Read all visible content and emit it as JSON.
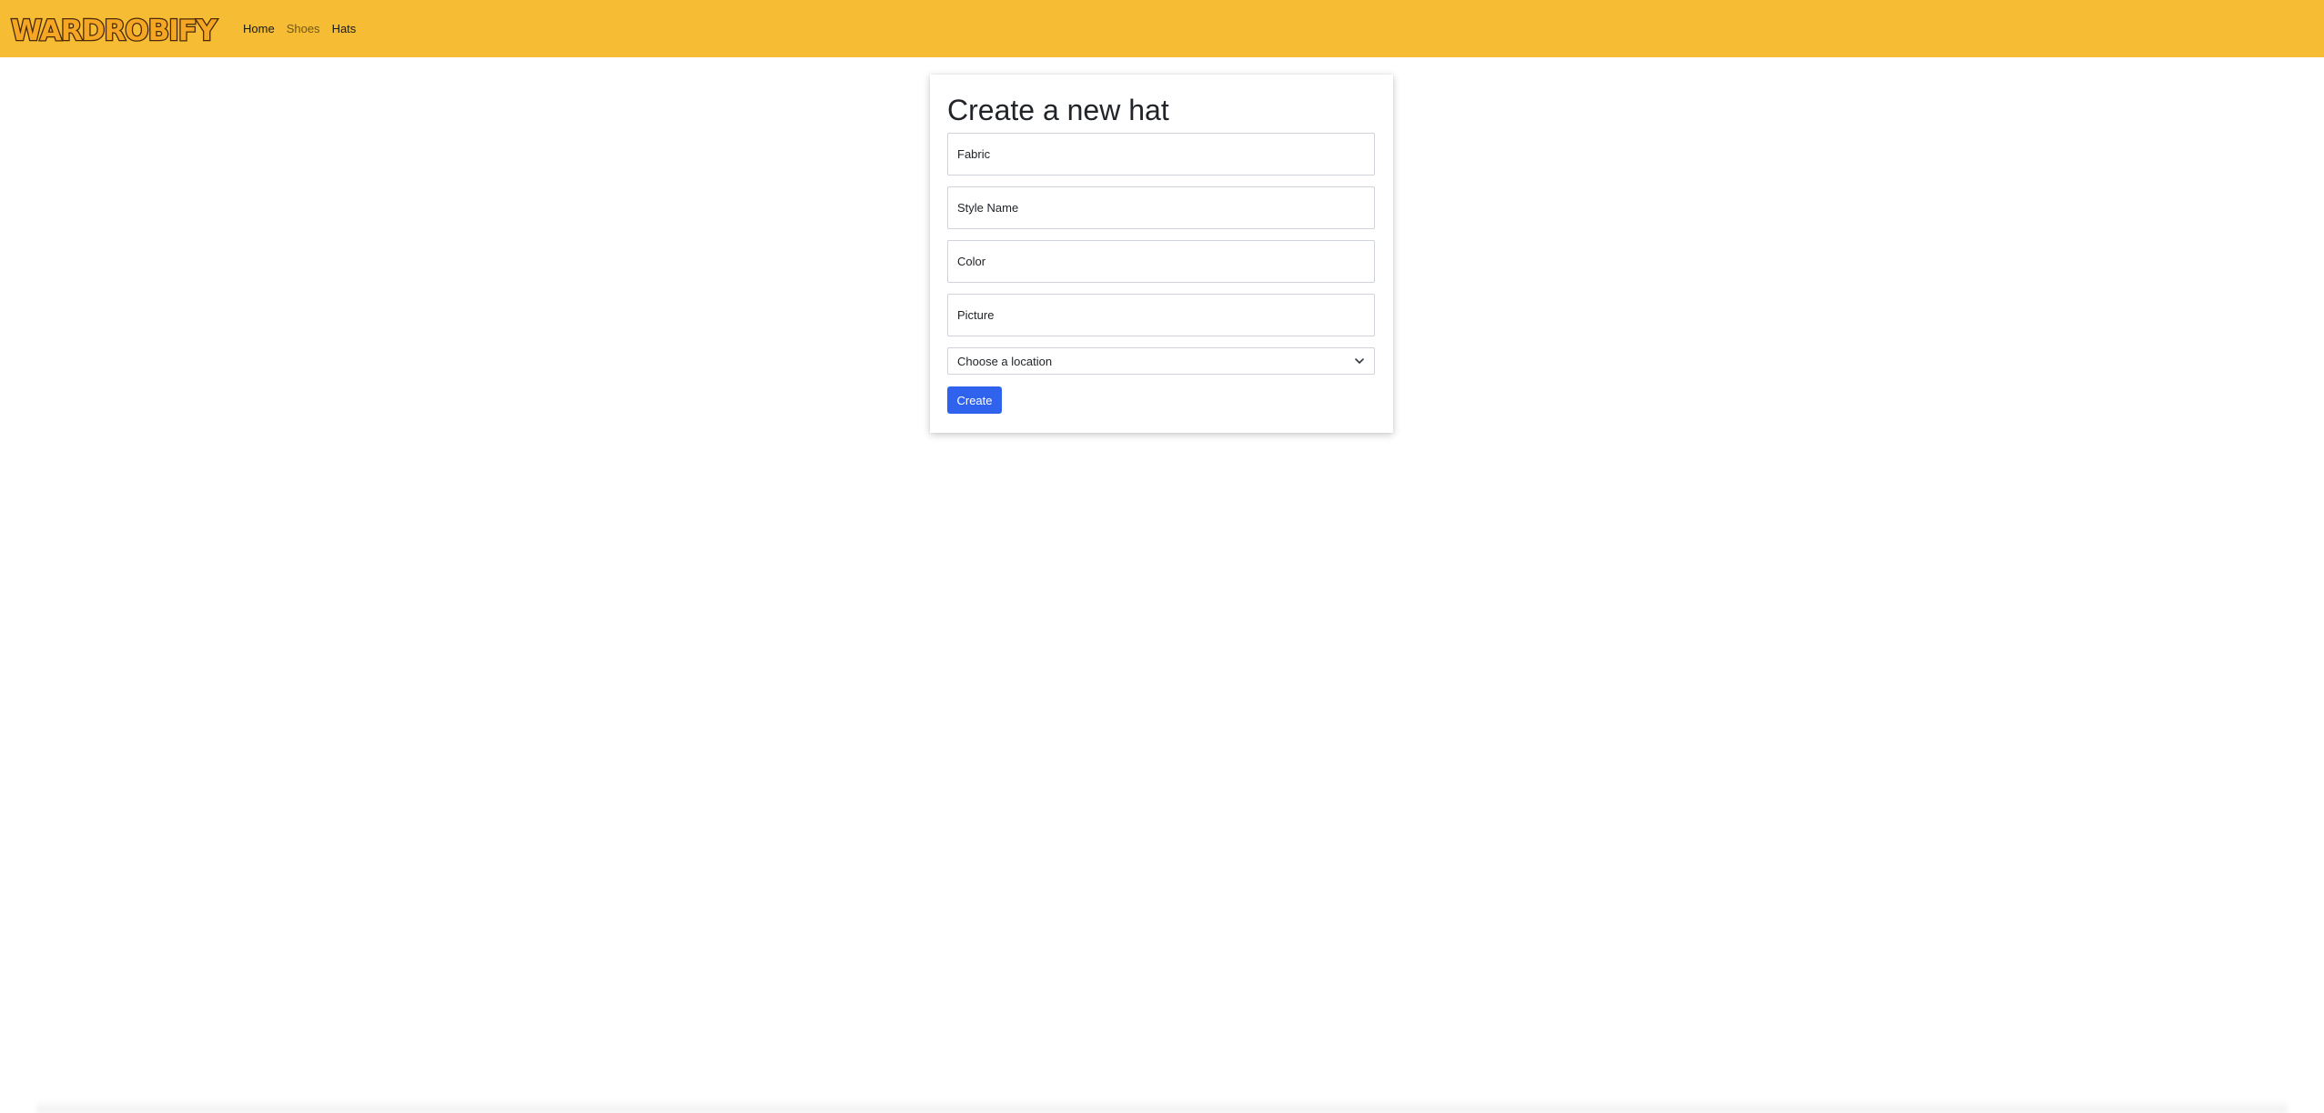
{
  "nav": {
    "logo_text": "WARDROBIFY",
    "links": [
      "Home",
      "Shoes",
      "Hats"
    ]
  },
  "form": {
    "title": "Create a new hat",
    "fields": [
      "Fabric",
      "Style Name",
      "Color",
      "Picture"
    ],
    "location_select": "Choose a location",
    "submit_label": "Create"
  },
  "colors": {
    "navbar": "#f6bc33",
    "button": "#2f63ee"
  }
}
